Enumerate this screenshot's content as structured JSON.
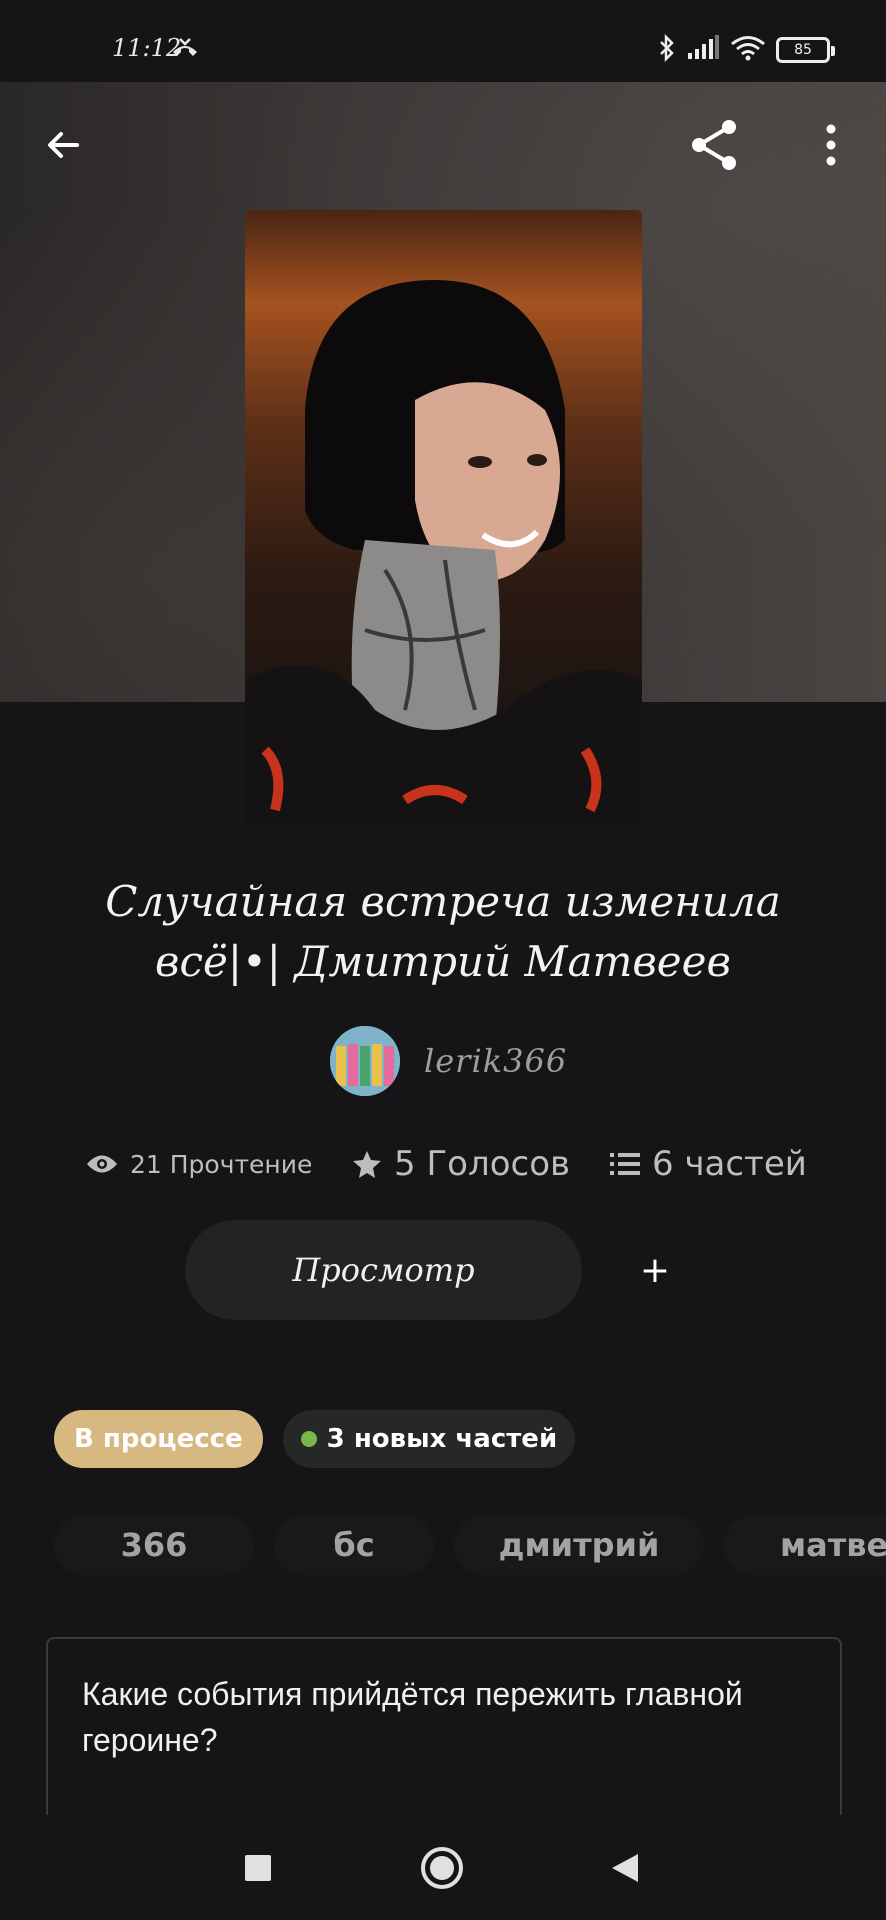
{
  "status_bar": {
    "time": "11:12",
    "battery": "85",
    "icons": [
      "missed-call-icon",
      "bluetooth-icon",
      "signal-icon",
      "wifi-icon",
      "battery-icon"
    ]
  },
  "header": {
    "icons": [
      "back-arrow-icon",
      "share-icon",
      "more-vertical-icon"
    ]
  },
  "story": {
    "title": "Случайная встреча изменила всё|•| Дмитрий Матвеев",
    "author": "lerik366",
    "stats": {
      "reads": "21 Прочтение",
      "votes": "5 Голосов",
      "parts": "6 частей"
    },
    "read_button": "Просмотр",
    "add_button": "+",
    "status_badge": "В процессе",
    "new_parts_badge": "3 новых частей",
    "tags": [
      "366",
      "бс",
      "дмитрий",
      "матвее"
    ],
    "description": "Какие события прийдётся пережить главной героине?\n\n© Все права защищены"
  },
  "colors": {
    "background": "#151416",
    "status_badge": "#d7b881",
    "new_dot": "#7ab648"
  }
}
